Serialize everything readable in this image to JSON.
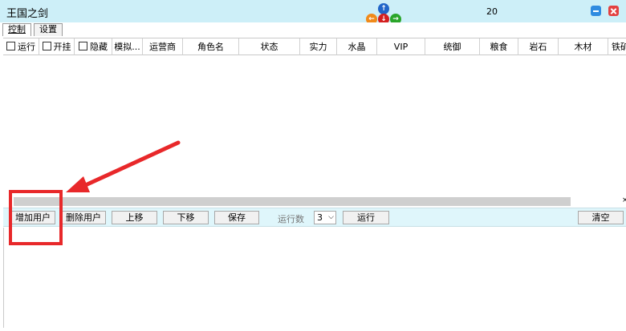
{
  "app": {
    "title": "王国之剑",
    "counter": "20"
  },
  "nav_arrows": {
    "up": "↑",
    "left": "←",
    "down": "↓",
    "right": "→"
  },
  "tabs": [
    {
      "label": "控制",
      "active": true
    },
    {
      "label": "设置",
      "active": false
    }
  ],
  "columns": [
    {
      "label": "运行",
      "checkbox": true
    },
    {
      "label": "开挂",
      "checkbox": true
    },
    {
      "label": "隐藏",
      "checkbox": true
    },
    {
      "label": "模拟...",
      "checkbox": false
    },
    {
      "label": "运营商",
      "checkbox": false
    },
    {
      "label": "角色名",
      "checkbox": false
    },
    {
      "label": "状态",
      "checkbox": false
    },
    {
      "label": "实力",
      "checkbox": false
    },
    {
      "label": "水晶",
      "checkbox": false
    },
    {
      "label": "VIP",
      "checkbox": false
    },
    {
      "label": "统御",
      "checkbox": false
    },
    {
      "label": "粮食",
      "checkbox": false
    },
    {
      "label": "岩石",
      "checkbox": false
    },
    {
      "label": "木材",
      "checkbox": false
    },
    {
      "label": "铁矿",
      "checkbox": false
    }
  ],
  "grid_rows": [],
  "scroll_end": "×",
  "toolbar": {
    "add_user": "增加用户",
    "delete_user": "删除用户",
    "move_up": "上移",
    "move_down": "下移",
    "save": "保存",
    "run_count_label": "运行数",
    "run_count_value": "3",
    "run": "运行",
    "clear": "清空"
  },
  "annotation": {
    "highlight_color": "#e8282a"
  },
  "colors": {
    "titlebar": "#cdeff8",
    "toolbar": "#dff6fb"
  }
}
